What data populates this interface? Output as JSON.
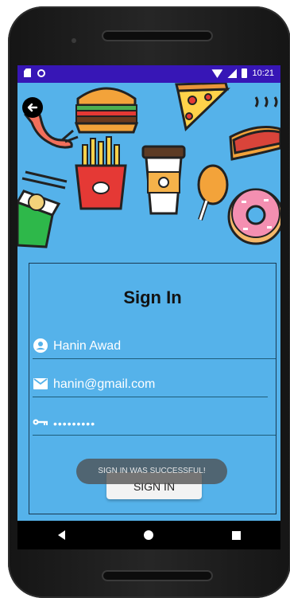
{
  "status_bar": {
    "time": "10:21",
    "left_icons": [
      "sd-card-icon",
      "sync-circle-icon"
    ],
    "right_icons": [
      "wifi-icon",
      "signal-icon",
      "battery-icon"
    ]
  },
  "header": {
    "back_icon": "arrow-left-icon",
    "illustration": [
      "shrimp",
      "burger",
      "pizza-slice",
      "hot-dog",
      "noodle-box",
      "french-fries",
      "coffee-cup",
      "chicken-drumstick",
      "donut"
    ]
  },
  "colors": {
    "status_bar": "#3716b6",
    "screen_bg": "#55b2ea",
    "field_line": "#1e5d7a",
    "card_border": "#1a3a52"
  },
  "form": {
    "title": "Sign In",
    "name_value": "Hanin Awad",
    "email_value": "hanin@gmail.com",
    "password_value": "•••••••••",
    "submit_label": "SIGN IN"
  },
  "toast": {
    "message": "SIGN IN WAS SUCCESSFUL!"
  },
  "nav": {
    "buttons": [
      "back",
      "home",
      "recents"
    ]
  }
}
